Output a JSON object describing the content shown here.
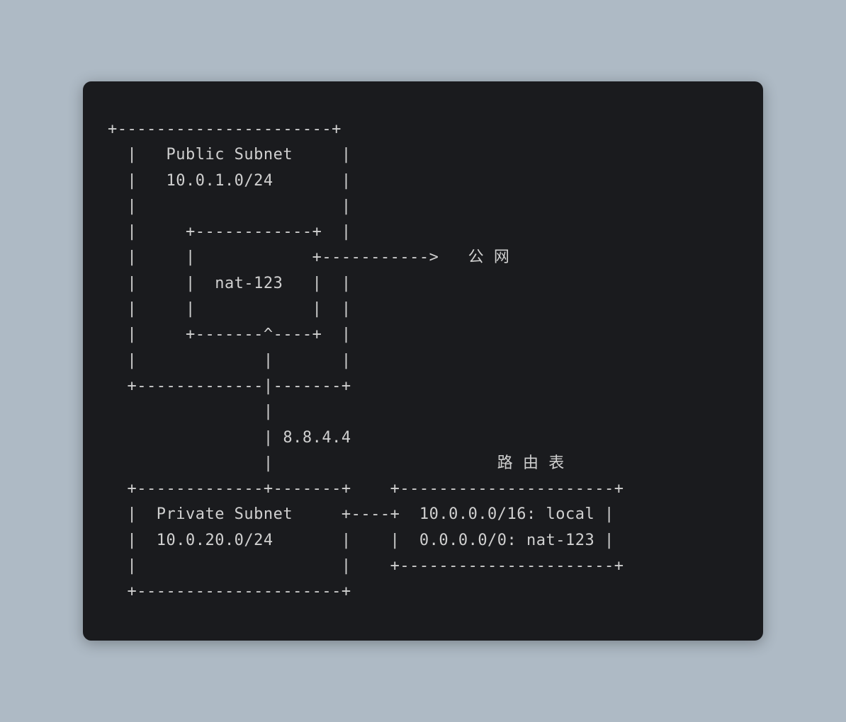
{
  "diagram": {
    "public_subnet": {
      "label": "Public Subnet",
      "cidr": "10.0.1.0/24",
      "nat_device": "nat-123"
    },
    "internet_label": "公 网",
    "traffic_ip": "8.8.4.4",
    "private_subnet": {
      "label": "Private Subnet",
      "cidr": "10.0.20.0/24"
    },
    "route_table": {
      "title": "路 由 表",
      "routes": [
        {
          "destination": "10.0.0.0/16",
          "target": "local"
        },
        {
          "destination": "0.0.0.0/0",
          "target": "nat-123"
        }
      ]
    }
  },
  "ascii_lines": [
    "+----------------------+",
    "  |   Public Subnet     |",
    "  |   10.0.1.0/24       |",
    "  |                     |",
    "  |     +------------+  |",
    "  |     |            +----------->   公 网",
    "  |     |  nat-123   |  |",
    "  |     |            |  |",
    "  |     +-------^----+  |",
    "  |             |       |",
    "  +-------------|-------+",
    "                |",
    "                | 8.8.4.4",
    "                |                       路 由 表",
    "  +-------------+-------+    +----------------------+",
    "  |  Private Subnet     +----+  10.0.0.0/16: local |",
    "  |  10.0.20.0/24       |    |  0.0.0.0/0: nat-123 |",
    "  |                     |    +----------------------+",
    "  +---------------------+"
  ]
}
